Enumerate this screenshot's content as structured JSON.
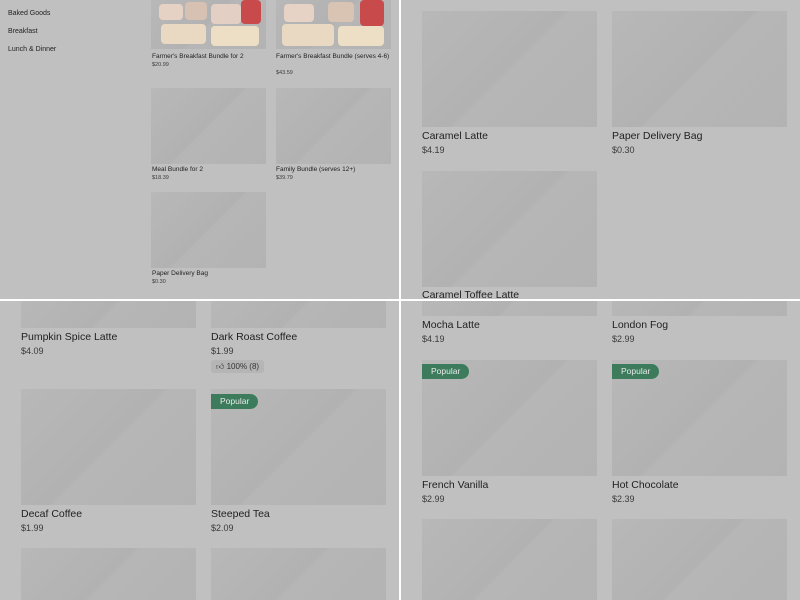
{
  "sidebar": {
    "categories": [
      "Baked Goods",
      "Breakfast",
      "Lunch & Dinner"
    ]
  },
  "bundles": [
    {
      "name": "Farmer's Breakfast Bundle for 2",
      "price": "$20.99"
    },
    {
      "name": "Farmer's Breakfast Bundle (serves 4-6)",
      "price": "$43.59"
    },
    {
      "name": "Meal Bundle for 2",
      "price": "$18.39"
    },
    {
      "name": "Family Bundle (serves 12+)",
      "price": "$39.79"
    },
    {
      "name": "Paper Delivery Bag",
      "price": "$0.30"
    }
  ],
  "panel2": [
    {
      "name": "Caramel Latte",
      "price": "$4.19"
    },
    {
      "name": "Paper Delivery Bag",
      "price": "$0.30"
    },
    {
      "name": "Caramel Toffee Latte"
    }
  ],
  "panel3": [
    {
      "name": "Pumpkin Spice Latte",
      "price": "$4.09"
    },
    {
      "name": "Dark Roast Coffee",
      "price": "$1.99",
      "rating": "100% (8)"
    },
    {
      "name": "Decaf Coffee",
      "price": "$1.99"
    },
    {
      "name": "Steeped Tea",
      "price": "$2.09",
      "badge": "Popular"
    }
  ],
  "panel4": [
    {
      "name": "Mocha Latte",
      "price": "$4.19"
    },
    {
      "name": "London Fog",
      "price": "$2.99"
    },
    {
      "name": "French Vanilla",
      "price": "$2.99",
      "badge": "Popular"
    },
    {
      "name": "Hot Chocolate",
      "price": "$2.39",
      "badge": "Popular"
    }
  ],
  "colors": {
    "panel_bg": "#c0c0c0",
    "image_placeholder": "#b8b8b8",
    "badge": "#3c7c5c",
    "divider": "#ffffff"
  }
}
